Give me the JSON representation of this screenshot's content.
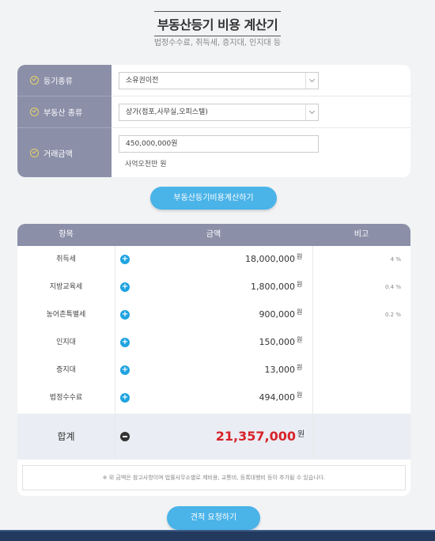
{
  "header": {
    "title": "부동산등기 비용 계산기",
    "subtitle": "법정수수료, 취득세, 증지대, 인지대 등"
  },
  "form": {
    "registration_type": {
      "label": "등기종류",
      "value": "소유권이전"
    },
    "property_type": {
      "label": "부동산 종류",
      "value": "상가(점포,사무실,오피스텔)"
    },
    "amount": {
      "label": "거래금액",
      "value": "450,000,000원",
      "hint": "사억오천만 원"
    }
  },
  "calc_button": "부동산등기비용계산하기",
  "table": {
    "headers": [
      "항목",
      "금액",
      "비고"
    ],
    "currency": "원",
    "rows": [
      {
        "name": "취득세",
        "amount": "18,000,000",
        "note": "4 %"
      },
      {
        "name": "지방교육세",
        "amount": "1,800,000",
        "note": "0.4 %"
      },
      {
        "name": "농어촌특별세",
        "amount": "900,000",
        "note": "0.2 %"
      },
      {
        "name": "인지대",
        "amount": "150,000",
        "note": ""
      },
      {
        "name": "증지대",
        "amount": "13,000",
        "note": ""
      },
      {
        "name": "법정수수료",
        "amount": "494,000",
        "note": ""
      }
    ],
    "total": {
      "name": "합계",
      "amount": "21,357,000",
      "won": "원"
    },
    "notice": "※ 위 금액은 참고사항이며 법률사무소별로 제비용, 교통비, 등록대행비 등이 추가될 수 있습니다."
  },
  "quote_button": "견적 요청하기",
  "colors": {
    "accent": "#4ab3e8",
    "header_bg": "#8b8fa8",
    "total_red": "#d8232a",
    "check_yellow": "#e6d26a"
  }
}
